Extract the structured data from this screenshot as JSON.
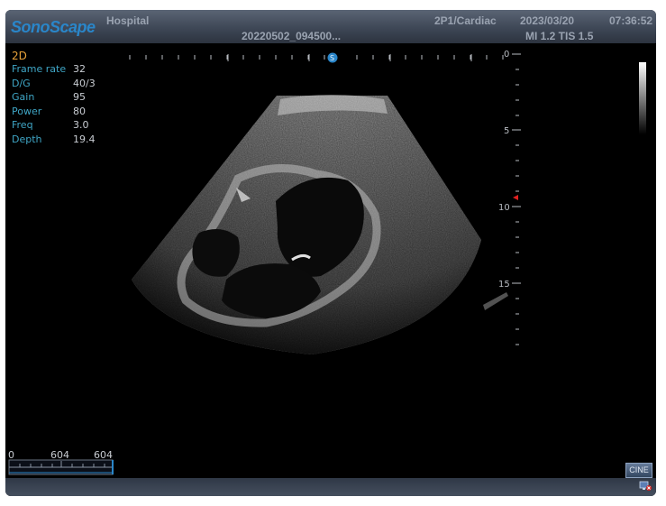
{
  "header": {
    "logo": "SonoScape",
    "hospital": "Hospital",
    "patient_id": "20220502_094500...",
    "mode_label": "2P1/Cardiac",
    "date": "2023/03/20",
    "time": "07:36:52",
    "mi_tis": "MI 1.2 TIS 1.5"
  },
  "params": {
    "mode": "2D",
    "rows": [
      {
        "label": "Frame rate",
        "value": "32"
      },
      {
        "label": "D/G",
        "value": "40/3"
      },
      {
        "label": "Gain",
        "value": "95"
      },
      {
        "label": "Power",
        "value": "80"
      },
      {
        "label": "Freq",
        "value": "3.0"
      },
      {
        "label": "Depth",
        "value": "19.4"
      }
    ]
  },
  "depth_scale": {
    "labels": [
      "0",
      "5",
      "10",
      "15"
    ]
  },
  "cine": {
    "start": "0",
    "current": "604",
    "total": "604",
    "button": "CINE"
  },
  "icons": {
    "probe_marker": "probe-orientation-icon",
    "focus_marker": "focus-marker-icon",
    "network": "network-status-icon"
  },
  "colors": {
    "accent_text": "#3fa6c6",
    "mode_text": "#e8a23a",
    "logo": "#2a86c9",
    "focus_marker": "#e02020"
  }
}
